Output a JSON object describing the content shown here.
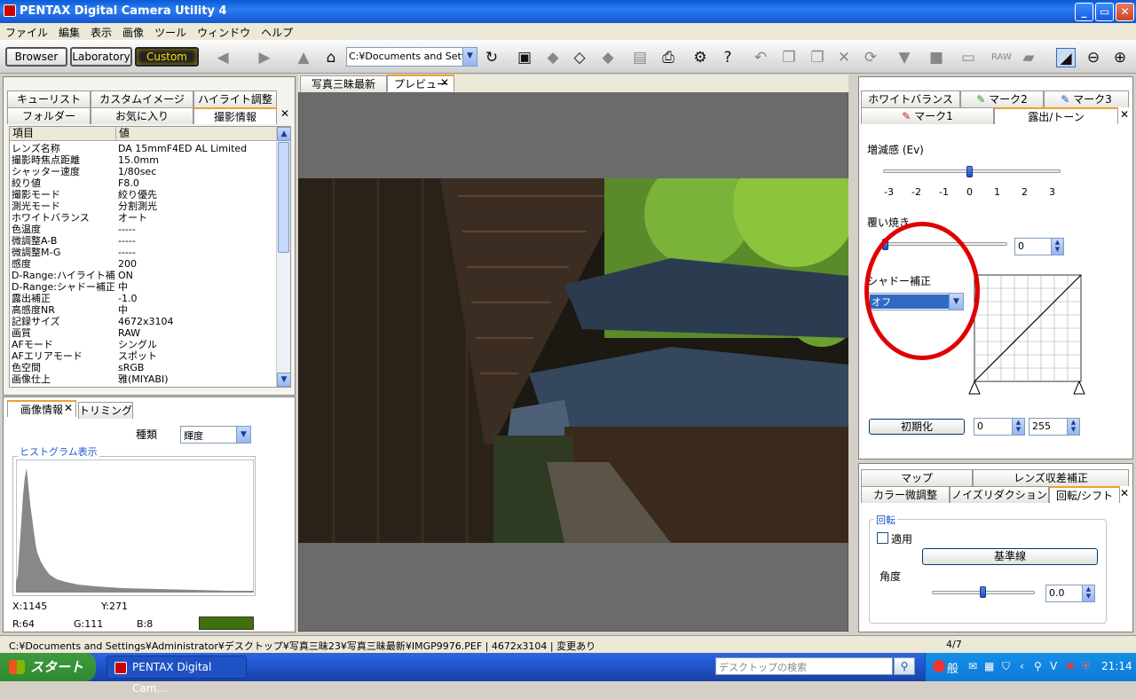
{
  "window": {
    "title": "PENTAX Digital Camera Utility 4",
    "controls": [
      "_",
      "▭",
      "✕"
    ]
  },
  "menu": [
    "ファイル",
    "編集",
    "表示",
    "画像",
    "ツール",
    "ウィンドウ",
    "ヘルプ"
  ],
  "toolbar": {
    "modes": [
      "Browser",
      "Laboratory",
      "Custom"
    ],
    "path": "C:¥Documents and Settir"
  },
  "left": {
    "tabs_row1": [
      "キューリスト",
      "カスタムイメージ",
      "ハイライト調整"
    ],
    "tabs_row2": [
      "フォルダー",
      "お気に入り",
      "撮影情報"
    ],
    "columns": [
      "項目",
      "値"
    ],
    "rows": [
      [
        "レンズ名称",
        "DA 15mmF4ED AL Limited"
      ],
      [
        "撮影時焦点距離",
        "15.0mm"
      ],
      [
        "シャッター速度",
        "1/80sec"
      ],
      [
        "絞り値",
        "F8.0"
      ],
      [
        "撮影モード",
        "絞り優先"
      ],
      [
        "測光モード",
        "分割測光"
      ],
      [
        "ホワイトバランス",
        "オート"
      ],
      [
        "色温度",
        "-----"
      ],
      [
        "微調整A-B",
        "-----"
      ],
      [
        "微調整M-G",
        "-----"
      ],
      [
        "感度",
        "200"
      ],
      [
        "D-Range:ハイライト補...",
        "ON"
      ],
      [
        "D-Range:シャドー補正",
        "中"
      ],
      [
        "露出補正",
        "-1.0"
      ],
      [
        "高感度NR",
        "中"
      ],
      [
        "記録サイズ",
        "4672x3104"
      ],
      [
        "画質",
        "RAW"
      ],
      [
        "AFモード",
        "シングル"
      ],
      [
        "AFエリアモード",
        "スポット"
      ],
      [
        "色空間",
        "sRGB"
      ],
      [
        "画像仕上",
        "雅(MIYABI)"
      ]
    ],
    "bottom_tabs": [
      "画像情報",
      "トリミング"
    ],
    "kind_label": "種類",
    "kind_value": "輝度",
    "hist_label": "ヒストグラム表示",
    "coords": {
      "x": "X:1145",
      "y": "Y:271"
    },
    "rgb": {
      "r": "R:64",
      "g": "G:111",
      "b": "B:8"
    },
    "swatch": "#40700a"
  },
  "center": {
    "tabs": [
      "写真三昧最新",
      "プレビュー"
    ]
  },
  "right": {
    "tabs_row1": [
      "ホワイトバランス",
      "マーク2",
      "マーク3"
    ],
    "tabs_row2": [
      "マーク1",
      "露出/トーン"
    ],
    "exposure_label": "増減感 (Ev)",
    "exposure_ticks": [
      "-3",
      "-2",
      "-1",
      "0",
      "1",
      "2",
      "3"
    ],
    "exposure_value": 0,
    "burn_label": "覆い焼き",
    "burn_value": "0",
    "shadow_label": "シャドー補正",
    "shadow_value": "オフ",
    "reset_label": "初期化",
    "low_value": "0",
    "high_value": "255",
    "tabs2_row1": [
      "マップ",
      "レンズ収差補正"
    ],
    "tabs2_row2": [
      "カラー微調整",
      "ノイズリダクション",
      "回転/シフト"
    ],
    "rotate_group": "回転",
    "apply_label": "適用",
    "baseline_label": "基準線",
    "angle_label": "角度",
    "angle_value": "0.0"
  },
  "status": {
    "path": "C:¥Documents and Settings¥Administrator¥デスクトップ¥写真三昧23¥写真三昧最新¥IMGP9976.PEF | 4672x3104 | 変更あり",
    "page": "4/7"
  },
  "taskbar": {
    "start": "スタート",
    "item": "PENTAX Digital Cam...",
    "search": "デスクトップの検索",
    "ime": "般",
    "clock": "21:14"
  }
}
